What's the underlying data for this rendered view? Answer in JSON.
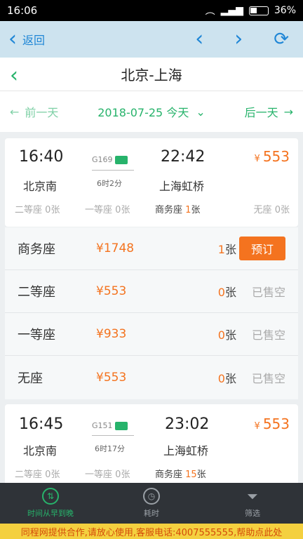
{
  "status": {
    "time": "16:06",
    "battery": "36%"
  },
  "browser": {
    "back_label": "返回",
    "back_icon": "chevron-left",
    "prev_icon": "chevron-left",
    "next_icon": "chevron-right",
    "refresh_icon": "refresh"
  },
  "header": {
    "title": "北京-上海"
  },
  "datebar": {
    "prev_label": "前一天",
    "date": "2018-07-25 今天",
    "next_label": "后一天"
  },
  "trains": [
    {
      "depart_time": "16:40",
      "arrive_time": "22:42",
      "depart_station": "北京南",
      "arrive_station": "上海虹桥",
      "train_no": "G169",
      "duration": "6时2分",
      "price_symbol": "¥",
      "price": "553",
      "seats": [
        {
          "label": "二等座",
          "count": "0",
          "unit": "张"
        },
        {
          "label": "一等座",
          "count": "0",
          "unit": "张"
        },
        {
          "label": "商务座",
          "count": "1",
          "unit": "张"
        },
        {
          "label": "无座",
          "count": "0",
          "unit": "张"
        }
      ]
    },
    {
      "depart_time": "16:45",
      "arrive_time": "23:02",
      "depart_station": "北京南",
      "arrive_station": "上海虹桥",
      "train_no": "G151",
      "duration": "6时17分",
      "price_symbol": "¥",
      "price": "553",
      "seats": [
        {
          "label": "二等座",
          "count": "0",
          "unit": "张"
        },
        {
          "label": "一等座",
          "count": "0",
          "unit": "张"
        },
        {
          "label": "商务座",
          "count": "15",
          "unit": "张"
        }
      ]
    }
  ],
  "seat_detail": [
    {
      "name": "商务座",
      "price": "¥1748",
      "count": "1",
      "unit": "张",
      "action": "预订"
    },
    {
      "name": "二等座",
      "price": "¥553",
      "count": "0",
      "unit": "张",
      "action": "已售空"
    },
    {
      "name": "一等座",
      "price": "¥933",
      "count": "0",
      "unit": "张",
      "action": "已售空"
    },
    {
      "name": "无座",
      "price": "¥553",
      "count": "0",
      "unit": "张",
      "action": "已售空"
    }
  ],
  "tabs": [
    {
      "label": "时间从早到晚",
      "icon": "sort"
    },
    {
      "label": "耗时",
      "icon": "clock"
    },
    {
      "label": "筛选",
      "icon": "filter"
    }
  ],
  "ad": {
    "text": "同程网提供合作,请放心使用,客服电话:4007555555,帮助点此处"
  },
  "colors": {
    "accent": "#27b36b",
    "price": "#f4731f",
    "link": "#1f86d6"
  }
}
